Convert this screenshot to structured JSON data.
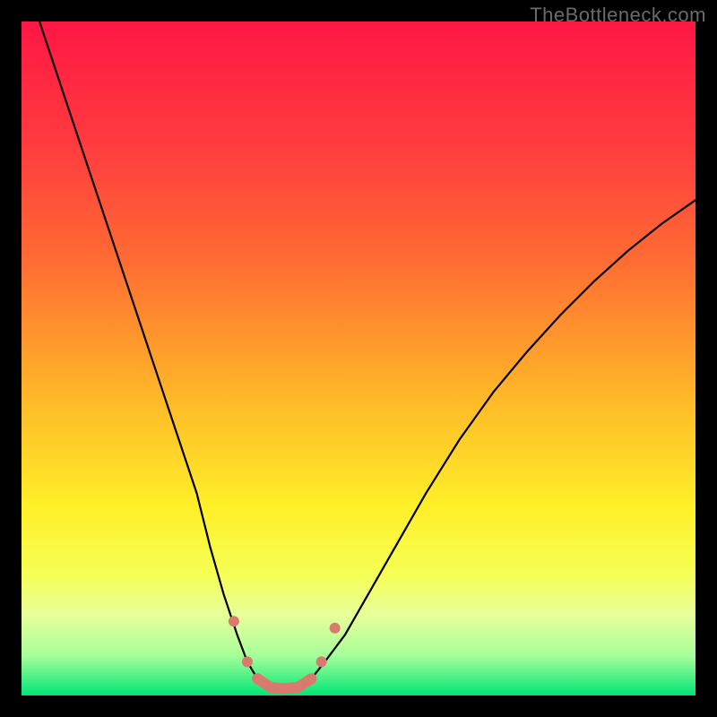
{
  "watermark": "TheBottleneck.com",
  "chart_data": {
    "type": "line",
    "title": "",
    "xlabel": "",
    "ylabel": "",
    "xlim": [
      0,
      100
    ],
    "ylim": [
      0,
      100
    ],
    "grid": false,
    "legend": false,
    "background_gradient": {
      "stops": [
        {
          "offset": 0,
          "color": "#ff1744"
        },
        {
          "offset": 18,
          "color": "#ff3b3f"
        },
        {
          "offset": 35,
          "color": "#ff6a33"
        },
        {
          "offset": 55,
          "color": "#ffb528"
        },
        {
          "offset": 72,
          "color": "#fff028"
        },
        {
          "offset": 82,
          "color": "#f5ff55"
        },
        {
          "offset": 88,
          "color": "#e8ff9a"
        },
        {
          "offset": 94,
          "color": "#a8ff9a"
        },
        {
          "offset": 100,
          "color": "#00e676"
        }
      ]
    },
    "series": [
      {
        "name": "bottleneck-curve",
        "stroke": "#000000",
        "stroke_width": 2.2,
        "x": [
          0,
          2,
          5,
          8,
          11,
          14,
          17,
          20,
          23,
          26,
          28,
          30,
          32,
          33.5,
          35,
          37,
          39,
          41,
          43,
          45,
          48,
          52,
          56,
          60,
          65,
          70,
          75,
          80,
          85,
          90,
          95,
          100
        ],
        "y": [
          108,
          102,
          93,
          84,
          75,
          66,
          57,
          48,
          39,
          30,
          22,
          15,
          9,
          5,
          2.5,
          1.2,
          1.0,
          1.2,
          2.5,
          5,
          9,
          16,
          23,
          30,
          38,
          45,
          51,
          56.5,
          61.5,
          66,
          70,
          73.5
        ]
      }
    ],
    "markers": {
      "name": "highlight-band",
      "stroke": "#d97a6f",
      "stroke_width": 12,
      "points_x": [
        31.5,
        33.5,
        35,
        37,
        39,
        41,
        43,
        44.5,
        46.5
      ],
      "points_y": [
        11,
        5,
        2.5,
        1.2,
        1.0,
        1.2,
        2.5,
        5,
        10
      ]
    }
  }
}
